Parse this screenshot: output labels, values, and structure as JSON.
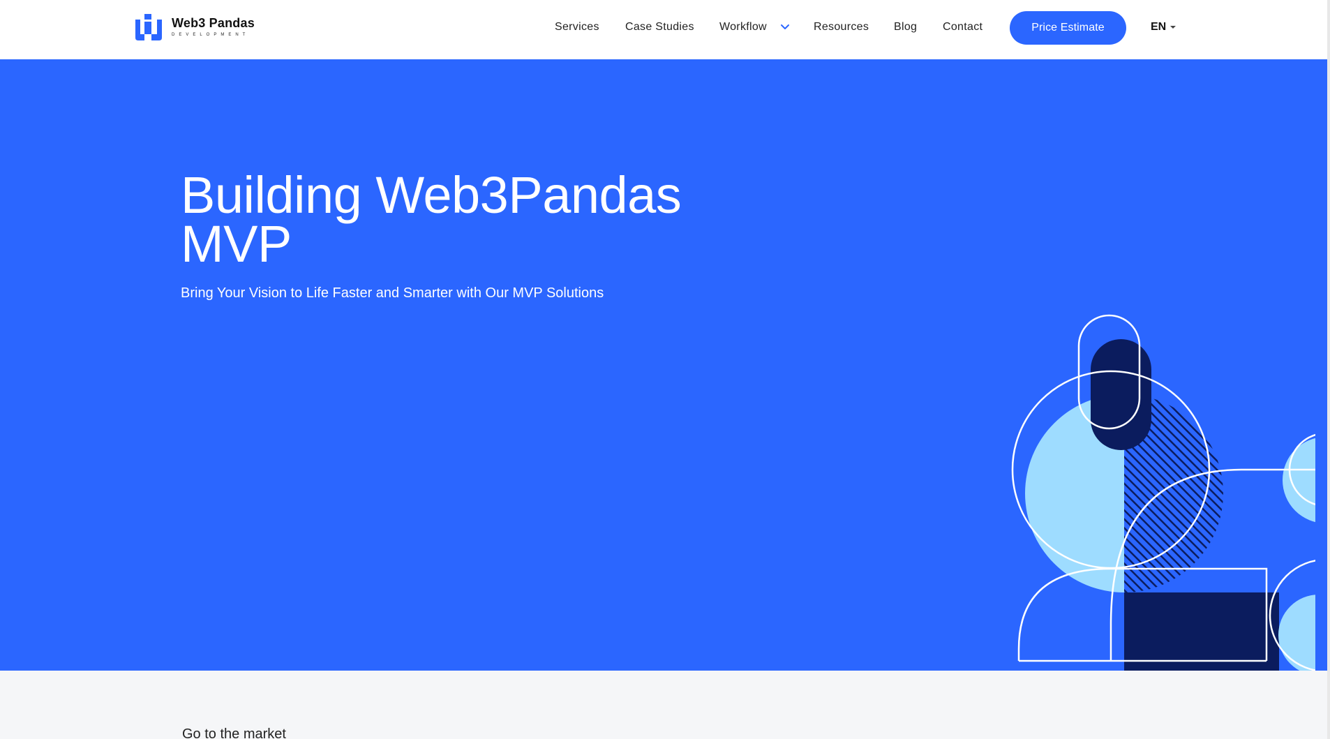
{
  "brand": {
    "name": "Web3 Pandas",
    "tagline": "DEVELOPMENT",
    "logo_icon": "web3pandas-logo-icon"
  },
  "nav": {
    "services": "Services",
    "case_studies": "Case Studies",
    "workflow": "Workflow",
    "resources": "Resources",
    "blog": "Blog",
    "contact": "Contact",
    "cta": "Price Estimate",
    "language": "EN"
  },
  "hero": {
    "title_line1": "Building Web3Pandas",
    "title_line2": "MVP",
    "subtitle": "Bring Your Vision to Life Faster and Smarter with Our MVP Solutions"
  },
  "next_section": {
    "heading": "Go to the market"
  },
  "colors": {
    "primary": "#2b66ff",
    "navy": "#0b1c5e",
    "light_blue": "#9edcff",
    "white": "#ffffff",
    "section_bg": "#f5f6f8"
  }
}
